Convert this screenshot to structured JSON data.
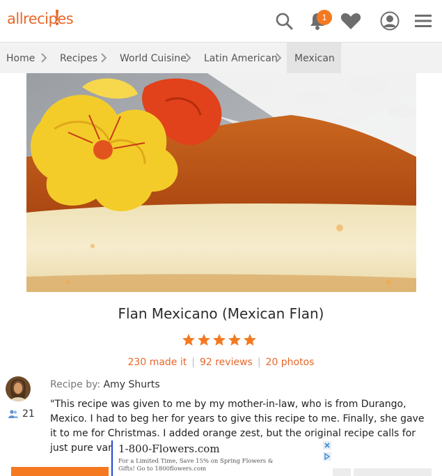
{
  "header": {
    "logo_text": "allrecipes",
    "notification_count": "1",
    "brand_color": "#e8672a",
    "icons": [
      "search-icon",
      "bell-icon",
      "heart-icon",
      "user-icon",
      "menu-icon"
    ]
  },
  "breadcrumb": {
    "items": [
      {
        "label": "Home"
      },
      {
        "label": "Recipes"
      },
      {
        "label": "World Cuisine"
      },
      {
        "label": "Latin American"
      },
      {
        "label": "Mexican",
        "active": true
      }
    ]
  },
  "recipe": {
    "title": "Flan Mexicano (Mexican Flan)",
    "rating": 5,
    "made_it": "230 made it",
    "reviews": "92 reviews",
    "photos": "20 photos",
    "recipe_by_label": "Recipe by:",
    "author": "Amy Shurts",
    "followers": "21",
    "description": "\"This recipe was given to me by my mother-in-law, who is from Durango, Mexico. I had to beg her for years to give this recipe to me. Finally, she gave it to me for Christmas. I added orange zest, but the original recipe calls for just pure vanilla. You can use a"
  },
  "ad": {
    "title": "1-800-Flowers.com",
    "text": "For a Limited Time, Save 15% on Spring Flowers & Gifts! Go to 1800flowers.com"
  }
}
